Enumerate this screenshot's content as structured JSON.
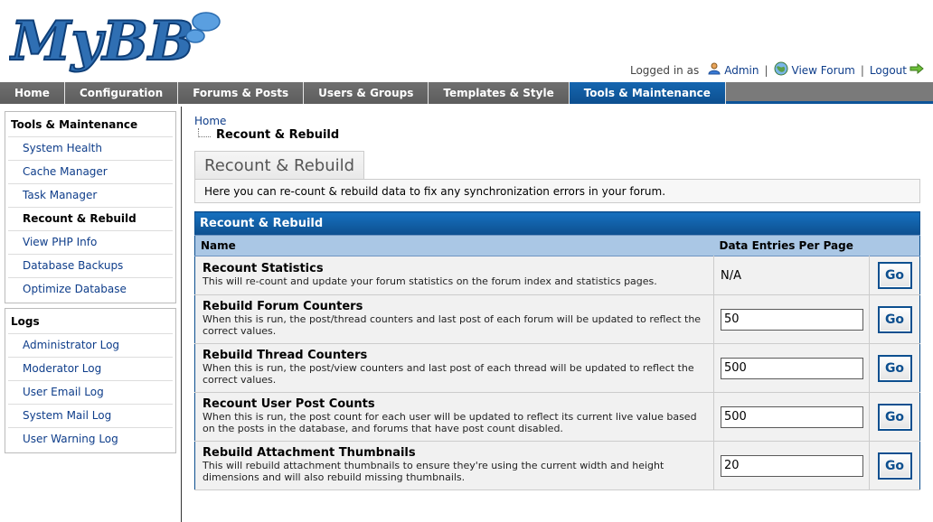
{
  "header": {
    "logo_text": "MyBB",
    "logged_in_label": "Logged in as",
    "user_link": "Admin",
    "view_forum_link": "View Forum",
    "logout_link": "Logout",
    "separator": "|"
  },
  "nav": {
    "tabs": [
      {
        "label": "Home"
      },
      {
        "label": "Configuration"
      },
      {
        "label": "Forums & Posts"
      },
      {
        "label": "Users & Groups"
      },
      {
        "label": "Templates & Style"
      },
      {
        "label": "Tools & Maintenance",
        "active": true
      }
    ]
  },
  "sidebar": {
    "tools": {
      "title": "Tools & Maintenance",
      "items": [
        {
          "label": "System Health"
        },
        {
          "label": "Cache Manager"
        },
        {
          "label": "Task Manager"
        },
        {
          "label": "Recount & Rebuild",
          "active": true
        },
        {
          "label": "View PHP Info"
        },
        {
          "label": "Database Backups"
        },
        {
          "label": "Optimize Database"
        }
      ]
    },
    "logs": {
      "title": "Logs",
      "items": [
        {
          "label": "Administrator Log"
        },
        {
          "label": "Moderator Log"
        },
        {
          "label": "User Email Log"
        },
        {
          "label": "System Mail Log"
        },
        {
          "label": "User Warning Log"
        }
      ]
    }
  },
  "breadcrumb": {
    "home": "Home",
    "current": "Recount & Rebuild"
  },
  "page": {
    "tab_title": "Recount & Rebuild",
    "description": "Here you can re-count & rebuild data to fix any synchronization errors in your forum."
  },
  "table": {
    "title": "Recount & Rebuild",
    "col_name": "Name",
    "col_entries": "Data Entries Per Page",
    "go_label": "Go",
    "rows": [
      {
        "title": "Recount Statistics",
        "desc": "This will re-count and update your forum statistics on the forum index and statistics pages.",
        "value": "N/A"
      },
      {
        "title": "Rebuild Forum Counters",
        "desc": "When this is run, the post/thread counters and last post of each forum will be updated to reflect the correct values.",
        "value": "50"
      },
      {
        "title": "Rebuild Thread Counters",
        "desc": "When this is run, the post/view counters and last post of each thread will be updated to reflect the correct values.",
        "value": "500"
      },
      {
        "title": "Recount User Post Counts",
        "desc": "When this is run, the post count for each user will be updated to reflect its current live value based on the posts in the database, and forums that have post count disabled.",
        "value": "500"
      },
      {
        "title": "Rebuild Attachment Thumbnails",
        "desc": "This will rebuild attachment thumbnails to ensure they're using the current width and height dimensions and will also rebuild missing thumbnails.",
        "value": "20"
      }
    ]
  },
  "colors": {
    "brand_blue": "#0d4f8f",
    "nav_gray": "#7f7f7f",
    "header_row": "#aac7e5"
  }
}
